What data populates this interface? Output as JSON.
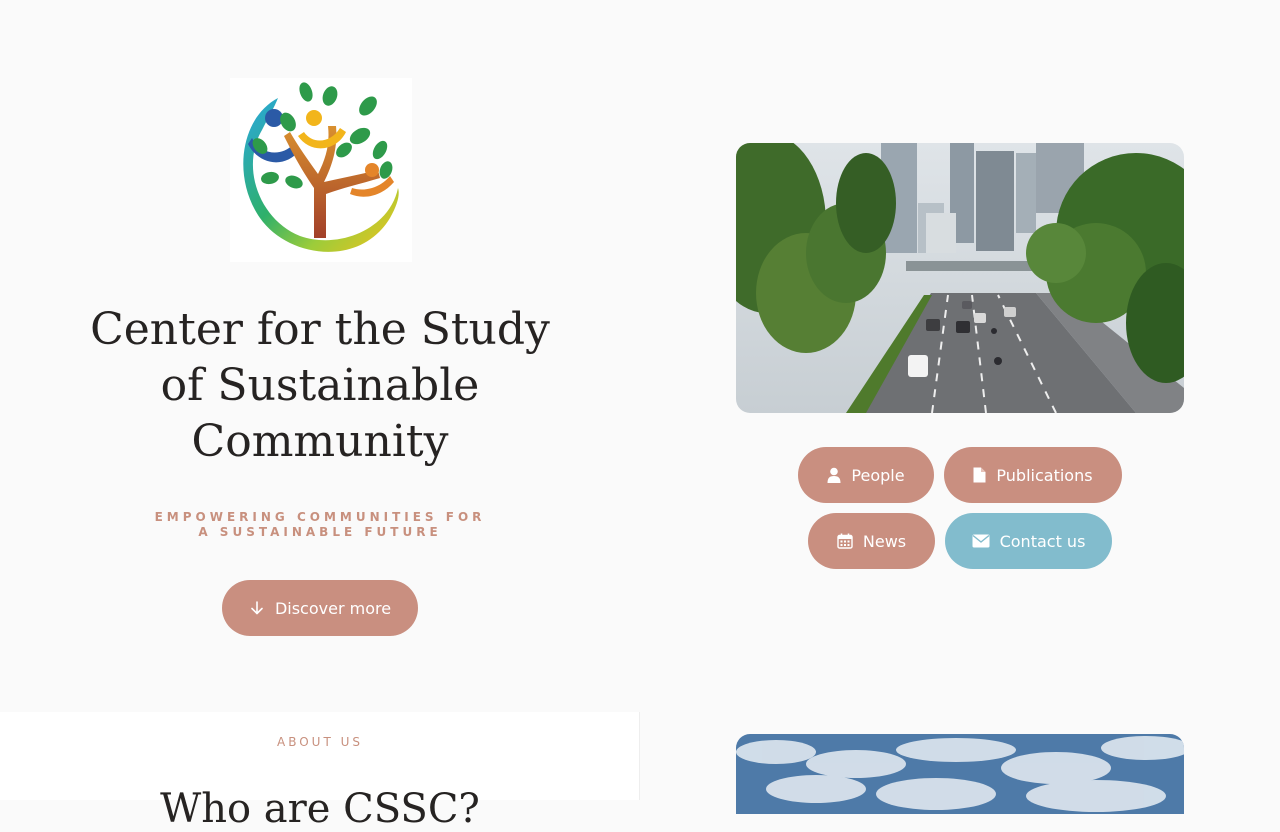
{
  "hero": {
    "title": "Center for the Study of Sustainable Community",
    "tagline": "EMPOWERING COMMUNITIES FOR A SUSTAINABLE FUTURE",
    "discover_label": "Discover more"
  },
  "nav_buttons": {
    "people": "People",
    "publications": "Publications",
    "news": "News",
    "contact": "Contact us"
  },
  "about": {
    "label": "ABOUT US",
    "heading": "Who are CSSC?"
  },
  "colors": {
    "accent": "#c98f80",
    "accent_text": "#c8907e",
    "contact": "#82bccd",
    "background": "#fafafa"
  },
  "icons": {
    "discover": "arrow-down-icon",
    "people": "user-icon",
    "publications": "document-icon",
    "news": "calendar-icon",
    "contact": "envelope-icon"
  }
}
